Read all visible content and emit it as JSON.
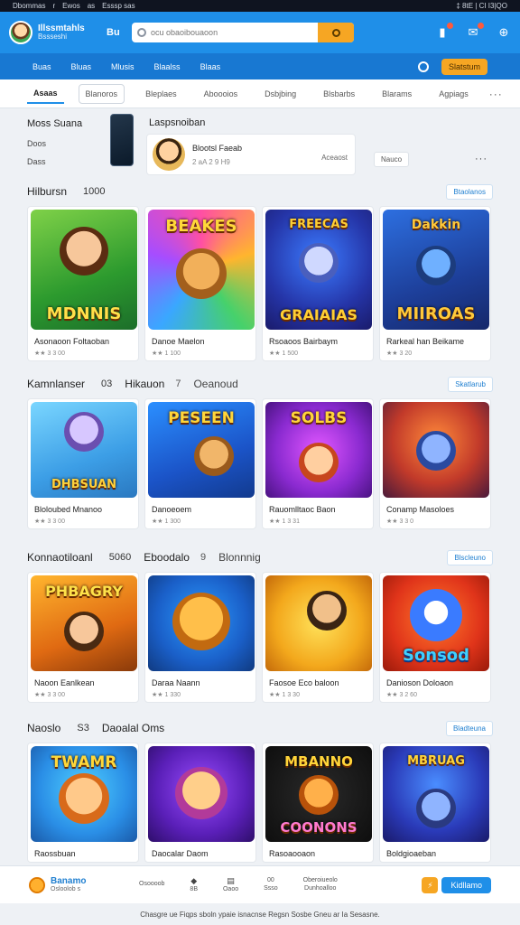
{
  "statusbar": {
    "left": [
      "Dbommas",
      "r",
      "Ewos",
      "as",
      "Esssp sas"
    ],
    "right": "‡ 8tE | CI I3|QO"
  },
  "header": {
    "brand_line1": "Illssmtahls",
    "brand_line2": "Bssseshi",
    "brand_tag": "Bu",
    "search_placeholder": "ocu obaoibouaoon",
    "icons": [
      "notification-icon",
      "chat-icon",
      "cart-icon"
    ]
  },
  "navbar": {
    "links": [
      "Buas",
      "Bluas",
      "Mlusis",
      "Blaalss",
      "Blaas"
    ],
    "action": "Slatstum"
  },
  "tabs": {
    "items": [
      "Asaas",
      "Blanoros",
      "Bleplaes",
      "Aboooios",
      "Dsbjbing",
      "Blsbarbs",
      "Blarams",
      "Agpiags"
    ],
    "more": "···"
  },
  "feature": {
    "left_title": "Moss Suana",
    "left_line2": "Doos",
    "left_line3": "Dass",
    "right_title": "Laspsnoiban",
    "card_name": "Blootsl Faeab",
    "card_meta": "2 aA 2 9 H9",
    "card_tag": "Aceaost",
    "button": "Nauco",
    "more": "···"
  },
  "sections": [
    {
      "title": "Hilbursn",
      "count": "1000",
      "all": "Btaolanos",
      "cards": [
        {
          "banner": "MDNNIS",
          "name": "Asonaoon Foltaoban",
          "rating": "★★ 3 3 00"
        },
        {
          "banner": "BEAKES",
          "name": "Danoe Maelon",
          "rating": "★★ 1 100"
        },
        {
          "banner": "GRAIAIAS",
          "banner_top": "FREECAS",
          "name": "Rsoaoos Bairbaym",
          "rating": "★★ 1 500"
        },
        {
          "banner": "MIIROAS",
          "banner_top": "Dakkin",
          "name": "Rarkeal han Beikame",
          "rating": "★★ 3 20"
        }
      ]
    },
    {
      "title": "Kamnlanser",
      "count": "03",
      "title2": "Hikauon",
      "count2": "7",
      "title3": "Oeanoud",
      "all": "Skatlarub",
      "cards": [
        {
          "banner": "DHBSUAN",
          "name": "Bloloubed Mnanoo",
          "rating": "★★ 3 3 00"
        },
        {
          "banner": "PESEEN",
          "name": "Danoeoem",
          "rating": "★★ 1 300"
        },
        {
          "banner": "SOLBS",
          "name": "Rauomlltaoc Baon",
          "rating": "★★ 1 3 31"
        },
        {
          "banner": "",
          "name": "Conamp Masoloes",
          "rating": "★★ 3 3 0"
        }
      ]
    },
    {
      "title": "Konnaotiloanl",
      "count": "5060",
      "title2": "Eboodalo",
      "count2": "9",
      "title3": "Blonnnig",
      "all": "Blscleuno",
      "cards": [
        {
          "banner": "PHBAGRY",
          "name": "Naoon Eanlkean",
          "rating": "★★ 3 3 00"
        },
        {
          "banner": "",
          "name": "Daraa Naann",
          "rating": "★★ 1 330"
        },
        {
          "banner": "",
          "name": "Faosoe Eco baloon",
          "rating": "★★ 1 3 30"
        },
        {
          "banner": "Sonsod",
          "name": "Danioson Doloaon",
          "rating": "★★ 3 2 60"
        }
      ]
    },
    {
      "title": "Naoslo",
      "count": "S3",
      "title2": "Daoalal Oms",
      "count2": "",
      "title3": "",
      "all": "Bladteuna",
      "cards": [
        {
          "banner": "TWAMR",
          "name": "Raossbuan",
          "rating": ""
        },
        {
          "banner": "",
          "name": "Daocalar Daom",
          "rating": ""
        },
        {
          "banner": "COONONS",
          "banner_top": "MBANNO",
          "name": "Rasoaooaon",
          "rating": ""
        },
        {
          "banner": "",
          "banner_top": "MBRUAG",
          "name": "Boldgioaeban",
          "rating": ""
        }
      ]
    }
  ],
  "bottombar": {
    "brand": "Banamo",
    "brand_sub": "Osloolob s",
    "items": [
      {
        "icon": "",
        "label": "Osoooob"
      },
      {
        "icon": "◆",
        "label": "8B"
      },
      {
        "icon": "▤",
        "label": "Oaoo"
      },
      {
        "icon": "",
        "label": "00\nSsso"
      },
      {
        "icon": "",
        "label": "Oberoiueolo\nDunhoalloo"
      }
    ],
    "button": "Kidllamo"
  },
  "footer": "Chasgre ue Fiqps sboln ypaie isnacnse Regsn Sosbe Gneu ar Ia Sesasne."
}
